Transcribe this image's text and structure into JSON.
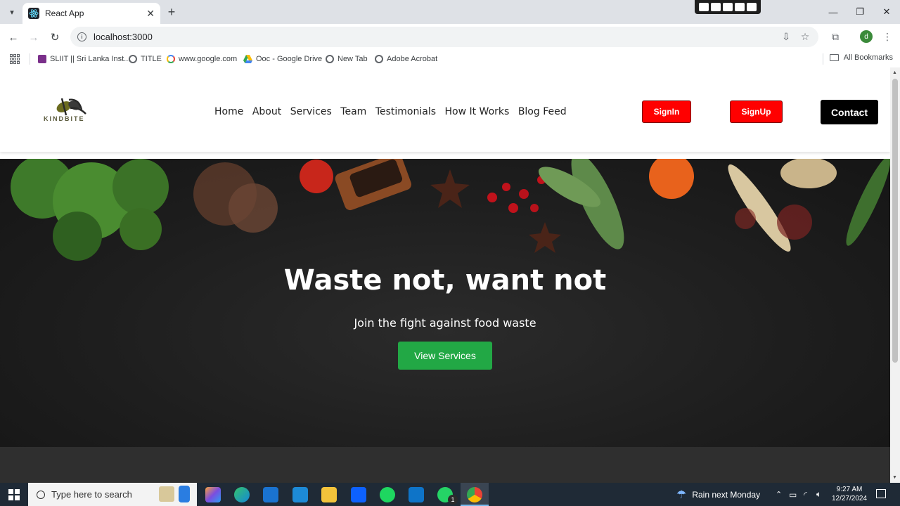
{
  "browser": {
    "tab_title": "React App",
    "url": "localhost:3000",
    "bookmarks": [
      "SLIIT || Sri Lanka Inst...",
      "TITLE",
      "www.google.com",
      "Ooc - Google Drive",
      "New Tab",
      "Adobe Acrobat"
    ],
    "all_bookmarks": "All Bookmarks",
    "profile_initial": "d"
  },
  "site": {
    "logo_text": "KINDBITE",
    "nav": [
      "Home",
      "About",
      "Services",
      "Team",
      "Testimonials",
      "How It Works",
      "Blog Feed"
    ],
    "signin_label": "SignIn",
    "signup_label": "SignUp",
    "contact_label": "Contact",
    "hero_title": "Waste not, want not",
    "hero_subtitle": "Join the fight against food waste",
    "hero_button": "View Services"
  },
  "taskbar": {
    "search_placeholder": "Type here to search",
    "weather": "Rain next Monday",
    "time": "9:27 AM",
    "date": "12/27/2024",
    "whatsapp_badge": "1"
  },
  "colors": {
    "signin_bg": "#ff0000",
    "contact_bg": "#000000",
    "hero_button_bg": "#22a845"
  }
}
